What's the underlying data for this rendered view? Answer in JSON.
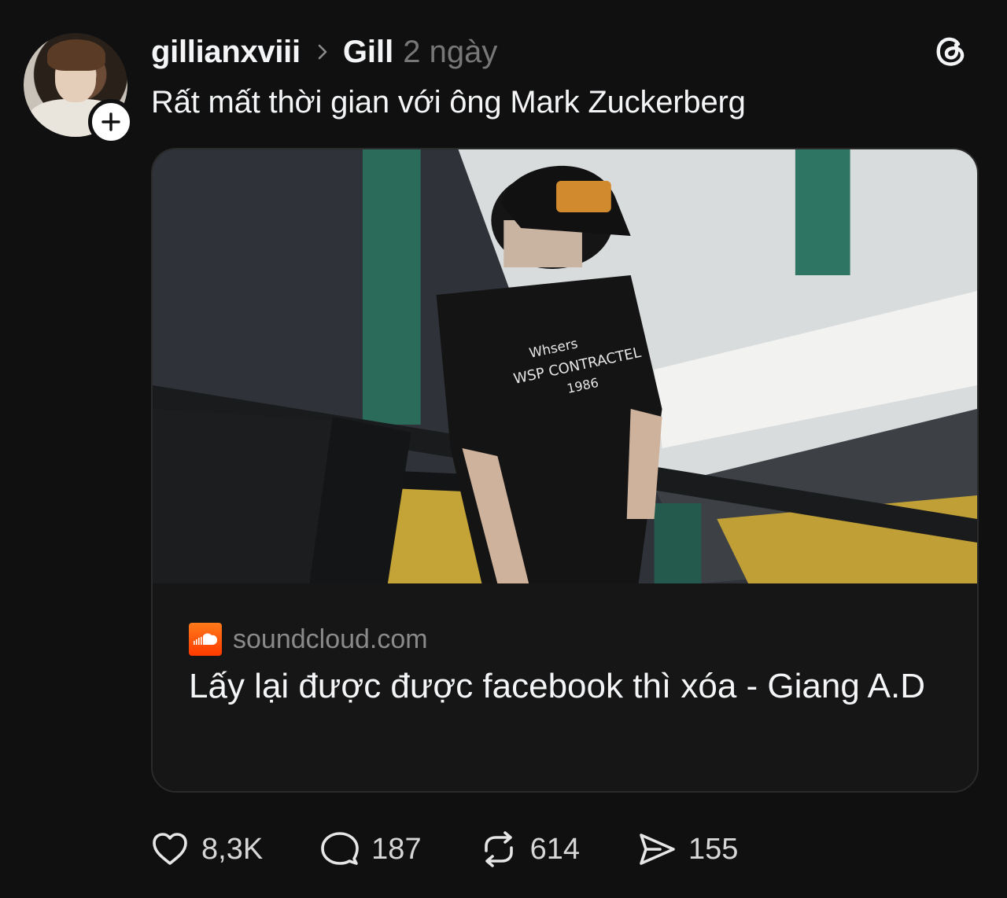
{
  "author": {
    "username": "gillianxviii",
    "reply_to": "Gill",
    "time": "2 ngày"
  },
  "post": {
    "caption": "Rất mất thời gian với ông Mark Zuckerberg"
  },
  "link_card": {
    "source": "soundcloud.com",
    "title": "Lấy lại được được facebook thì xóa - Giang A.D",
    "image_shirt_text": [
      "Whsers",
      "WSP CONTRACTEL",
      "1986"
    ]
  },
  "actions": {
    "likes": "8,3K",
    "replies": "187",
    "reposts": "614",
    "shares": "155"
  },
  "icons": {
    "follow": "plus-icon",
    "app": "threads-logo-icon",
    "source": "soundcloud-icon",
    "like": "heart-icon",
    "reply": "comment-icon",
    "repost": "repost-icon",
    "share": "send-icon"
  },
  "colors": {
    "background": "#101010",
    "text": "#f3f5f7",
    "muted": "#777777",
    "soundcloud": "#ff5500"
  }
}
